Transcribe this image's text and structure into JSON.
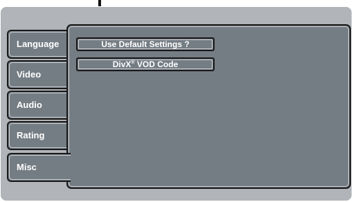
{
  "tabs": [
    {
      "label": "Language"
    },
    {
      "label": "Video"
    },
    {
      "label": "Audio"
    },
    {
      "label": "Rating"
    },
    {
      "label": "Misc"
    }
  ],
  "active_tab": "Misc",
  "menu": {
    "default_settings_label": "Use Default Settings ?",
    "divx_label": "DivX",
    "divx_mark": "®",
    "vod_label": "VOD Code"
  },
  "colors": {
    "panel": "#757d84",
    "frame": "#b1b5b9",
    "text": "#ffffff",
    "outline": "#1a1a1a"
  }
}
